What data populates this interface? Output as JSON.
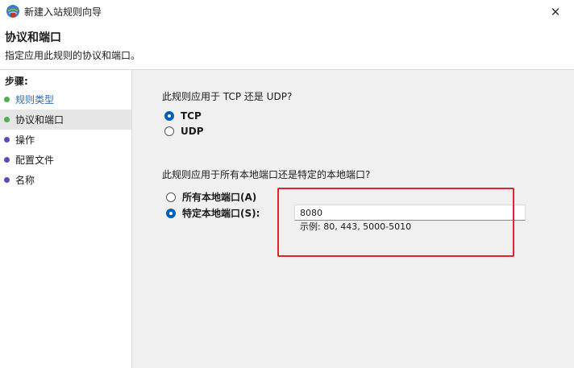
{
  "window": {
    "title": "新建入站规则向导",
    "close_glyph": "✕"
  },
  "header": {
    "title": "协议和端口",
    "subtitle": "指定应用此规则的协议和端口。"
  },
  "sidebar": {
    "steps_label": "步骤:",
    "steps": [
      {
        "label": "规则类型",
        "status": "done"
      },
      {
        "label": "协议和端口",
        "status": "current"
      },
      {
        "label": "操作",
        "status": "pending"
      },
      {
        "label": "配置文件",
        "status": "pending"
      },
      {
        "label": "名称",
        "status": "pending"
      }
    ]
  },
  "protocol": {
    "question": "此规则应用于 TCP 还是 UDP?",
    "options": [
      {
        "label": "TCP",
        "selected": true
      },
      {
        "label": "UDP",
        "selected": false
      }
    ]
  },
  "ports": {
    "question": "此规则应用于所有本地端口还是特定的本地端口?",
    "all_ports_label": "所有本地端口(A)",
    "all_ports_selected": false,
    "specific_ports_label": "特定本地端口(S):",
    "specific_ports_selected": true,
    "value": "8080",
    "example": "示例: 80, 443, 5000-5010"
  },
  "colors": {
    "accent": "#005fb8",
    "done_dot": "#4caf50",
    "pending_dot": "#5b4bb7",
    "highlight": "#e0262d"
  }
}
